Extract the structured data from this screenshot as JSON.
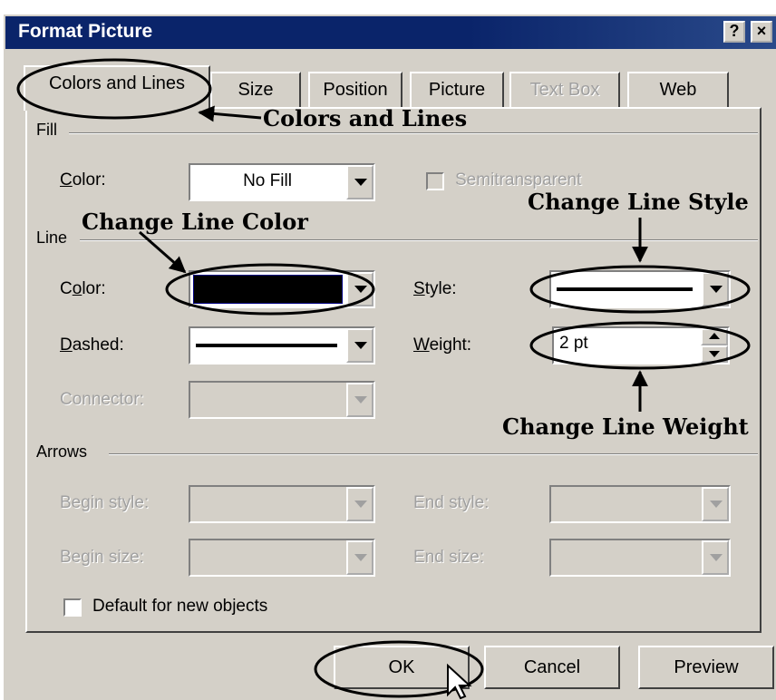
{
  "window": {
    "title": "Format Picture",
    "help_button": "?",
    "close_button": "×"
  },
  "tabs": [
    {
      "label": "Colors and Lines",
      "active": true,
      "enabled": true
    },
    {
      "label": "Size",
      "enabled": true
    },
    {
      "label": "Position",
      "enabled": true
    },
    {
      "label": "Picture",
      "enabled": true
    },
    {
      "label": "Text Box",
      "enabled": false
    },
    {
      "label": "Web",
      "enabled": true
    }
  ],
  "fill": {
    "group_label": "Fill",
    "color_label": "Color:",
    "color_value": "No Fill",
    "semitransparent_label": "Semitransparent",
    "semitransparent_checked": false
  },
  "line": {
    "group_label": "Line",
    "color_label": "Color:",
    "color_value": "#000000",
    "style_label": "Style:",
    "dashed_label": "Dashed:",
    "weight_label": "Weight:",
    "weight_value": "2 pt",
    "connector_label": "Connector:"
  },
  "arrows": {
    "group_label": "Arrows",
    "begin_style_label": "Begin style:",
    "end_style_label": "End style:",
    "begin_size_label": "Begin size:",
    "end_size_label": "End size:"
  },
  "default_checkbox": {
    "label": "Default for new objects",
    "checked": false
  },
  "buttons": {
    "ok": "OK",
    "cancel": "Cancel",
    "preview": "Preview"
  },
  "annotations": {
    "colors_and_lines": "Colors and Lines",
    "change_line_color": "Change Line Color",
    "change_line_style": "Change Line Style",
    "change_line_weight": "Change Line Weight"
  },
  "colors": {
    "title_bar": "#0a246a",
    "dialog_face": "#d4d0c8",
    "disabled_text": "#a0a0a0"
  }
}
